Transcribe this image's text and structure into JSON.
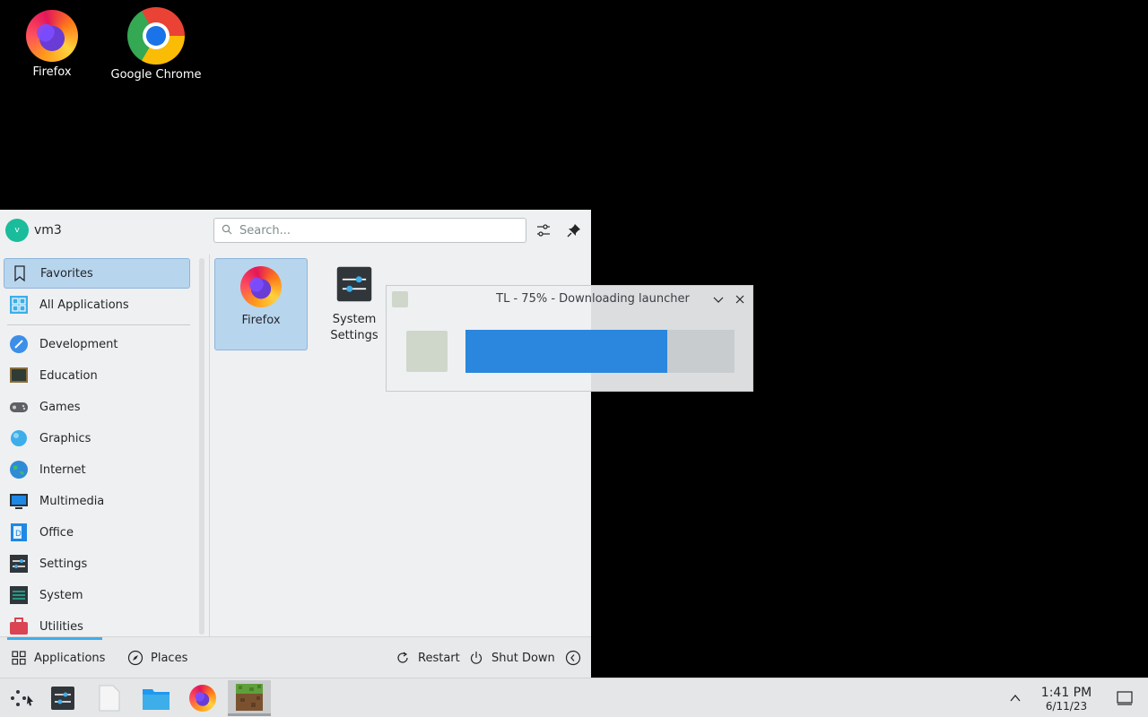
{
  "desktop": {
    "icons": [
      {
        "label": "Firefox",
        "icon": "firefox-icon"
      },
      {
        "label": "Google Chrome",
        "icon": "chrome-icon"
      }
    ]
  },
  "launcher": {
    "user": {
      "initial": "v",
      "name": "vm3"
    },
    "search": {
      "placeholder": "Search..."
    },
    "categories": [
      {
        "label": "Favorites",
        "icon": "bookmark-icon",
        "selected": true
      },
      {
        "label": "All Applications",
        "icon": "grid-icon"
      },
      {
        "label": "Development",
        "icon": "development-icon"
      },
      {
        "label": "Education",
        "icon": "education-icon"
      },
      {
        "label": "Games",
        "icon": "gamepad-icon"
      },
      {
        "label": "Graphics",
        "icon": "graphics-icon"
      },
      {
        "label": "Internet",
        "icon": "globe-icon"
      },
      {
        "label": "Multimedia",
        "icon": "multimedia-icon"
      },
      {
        "label": "Office",
        "icon": "office-icon"
      },
      {
        "label": "Settings",
        "icon": "settings-icon"
      },
      {
        "label": "System",
        "icon": "system-icon"
      },
      {
        "label": "Utilities",
        "icon": "utilities-icon"
      }
    ],
    "favorites": [
      {
        "label": "Firefox",
        "icon": "firefox-icon"
      },
      {
        "label": "System Settings",
        "label_line1": "System",
        "label_line2": "Settings",
        "icon": "system-settings-icon"
      }
    ],
    "footer": {
      "applications": "Applications",
      "places": "Places",
      "restart": "Restart",
      "shutdown": "Shut Down"
    }
  },
  "dialog": {
    "title": "TL - 75% - Downloading launcher",
    "progress": 0.75
  },
  "taskbar": {
    "items": [
      "app-launcher-icon",
      "system-settings-icon",
      "file-icon",
      "folder-icon",
      "firefox-icon",
      "minecraft-icon"
    ],
    "clock": {
      "time": "1:41 PM",
      "date": "6/11/23"
    }
  },
  "colors": {
    "accent": "#3daee9",
    "progress": "#2a87dd",
    "selection": "#b8d5ee"
  }
}
